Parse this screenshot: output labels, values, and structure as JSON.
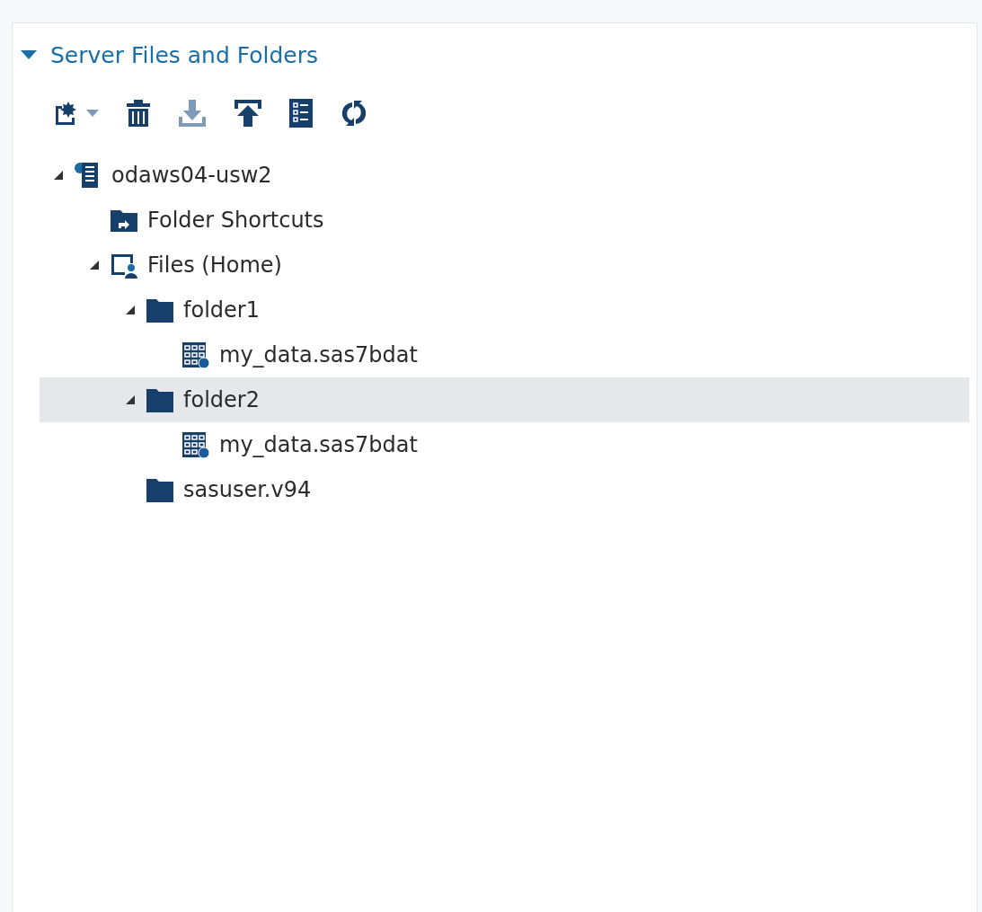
{
  "section": {
    "title": "Server Files and Folders",
    "expanded": true
  },
  "toolbar": [
    {
      "kind": "new",
      "disabled": false
    },
    {
      "kind": "delete",
      "disabled": false
    },
    {
      "kind": "download",
      "disabled": true
    },
    {
      "kind": "upload",
      "disabled": false
    },
    {
      "kind": "properties",
      "disabled": false
    },
    {
      "kind": "refresh",
      "disabled": false
    }
  ],
  "tree": [
    {
      "kind": "server",
      "label": "odaws04-usw2",
      "expanded": true,
      "selected": false,
      "children": [
        {
          "kind": "shortcuts",
          "label": "Folder Shortcuts",
          "selected": false
        },
        {
          "kind": "home",
          "label": "Files (Home)",
          "expanded": true,
          "selected": false,
          "children": [
            {
              "kind": "folder",
              "label": "folder1",
              "expanded": true,
              "selected": false,
              "children": [
                {
                  "kind": "table",
                  "label": "my_data.sas7bdat",
                  "selected": false
                }
              ]
            },
            {
              "kind": "folder",
              "label": "folder2",
              "expanded": true,
              "selected": true,
              "children": [
                {
                  "kind": "table",
                  "label": "my_data.sas7bdat",
                  "selected": false
                }
              ]
            },
            {
              "kind": "folder",
              "label": "sasuser.v94",
              "selected": false
            }
          ]
        }
      ]
    }
  ]
}
